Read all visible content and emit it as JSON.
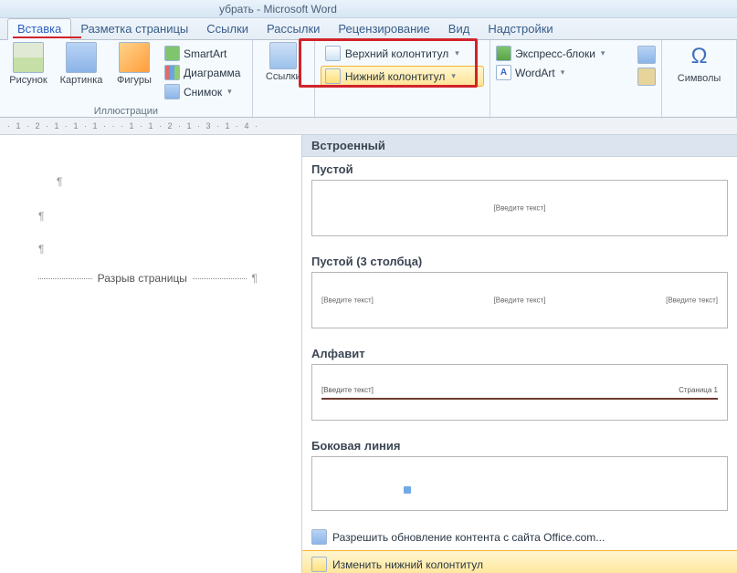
{
  "title": "убрать - Microsoft Word",
  "tabs": [
    "Вставка",
    "Разметка страницы",
    "Ссылки",
    "Рассылки",
    "Рецензирование",
    "Вид",
    "Надстройки"
  ],
  "active_tab": 0,
  "ribbon": {
    "group1": {
      "big": [
        {
          "name": "picture",
          "label": "Рисунок"
        },
        {
          "name": "clip",
          "label": "Картинка"
        },
        {
          "name": "shapes",
          "label": "Фигуры"
        }
      ],
      "small": [
        "SmartArt",
        "Диаграмма",
        "Снимок"
      ],
      "caption": "Иллюстрации"
    },
    "links": {
      "big": "Ссылки"
    },
    "hf": {
      "top": "Верхний колонтитул",
      "bottom": "Нижний колонтитул"
    },
    "text": {
      "blocks": "Экспресс-блоки",
      "wordart": "WordArt"
    },
    "symbols": {
      "label": "Символы",
      "omega": "Ω"
    }
  },
  "ruler": "· 1 · 2 · 1 · 1 · 1 ·  ·  · 1 · 1 · 2 · 1 · 3 · 1 · 4 ·",
  "page": {
    "mark1": "¶",
    "mark2": "¶",
    "mark3": "¶",
    "page_break": "Разрыв страницы",
    "end": "¶"
  },
  "gallery": {
    "header": "Встроенный",
    "empty": "Пустой",
    "placeholder": "[Введите текст]",
    "empty3": "Пустой (3 столбца)",
    "alphabet": "Алфавит",
    "alphabet_r": "Страница 1",
    "sideline": "Боковая линия",
    "allow_update": "Разрешить обновление контента с сайта Office.com...",
    "edit": "Изменить нижний колонтитул"
  }
}
